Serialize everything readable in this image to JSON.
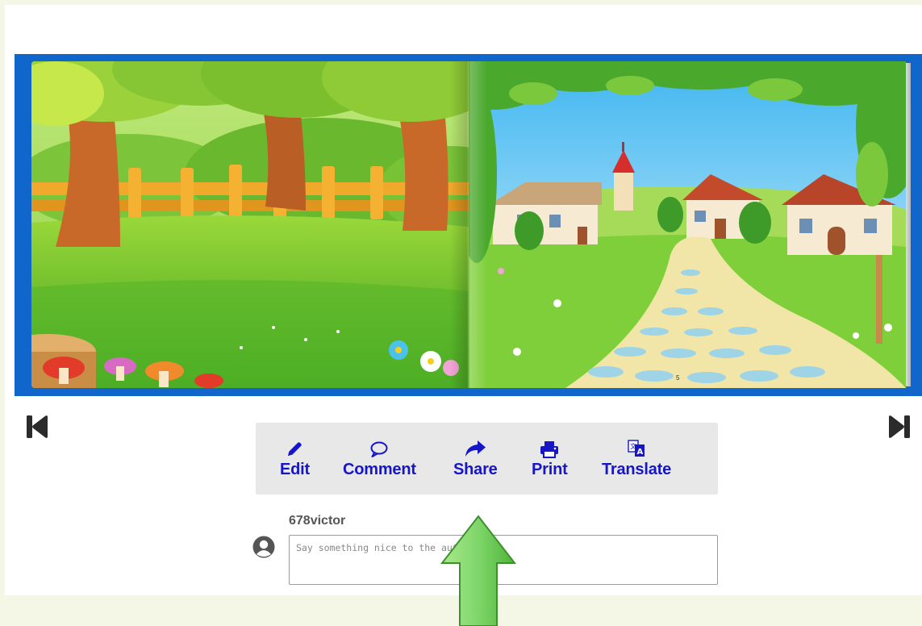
{
  "book": {
    "left_page_scene": "forest-with-fence-and-mushrooms",
    "right_page_scene": "village-with-cobblestone-path",
    "page_number": "5",
    "frame_color": "#1166cc"
  },
  "navigation": {
    "prev_icon": "skip-back-icon",
    "next_icon": "skip-forward-icon"
  },
  "toolbar": {
    "edit": "Edit",
    "comment": "Comment",
    "share": "Share",
    "print": "Print",
    "translate": "Translate",
    "accent_color": "#1616c8"
  },
  "comments": {
    "username": "678victor",
    "placeholder": "Say something nice to the author..."
  },
  "annotation": {
    "color": "#7fd66a",
    "icon": "up-arrow-annotation-icon"
  }
}
